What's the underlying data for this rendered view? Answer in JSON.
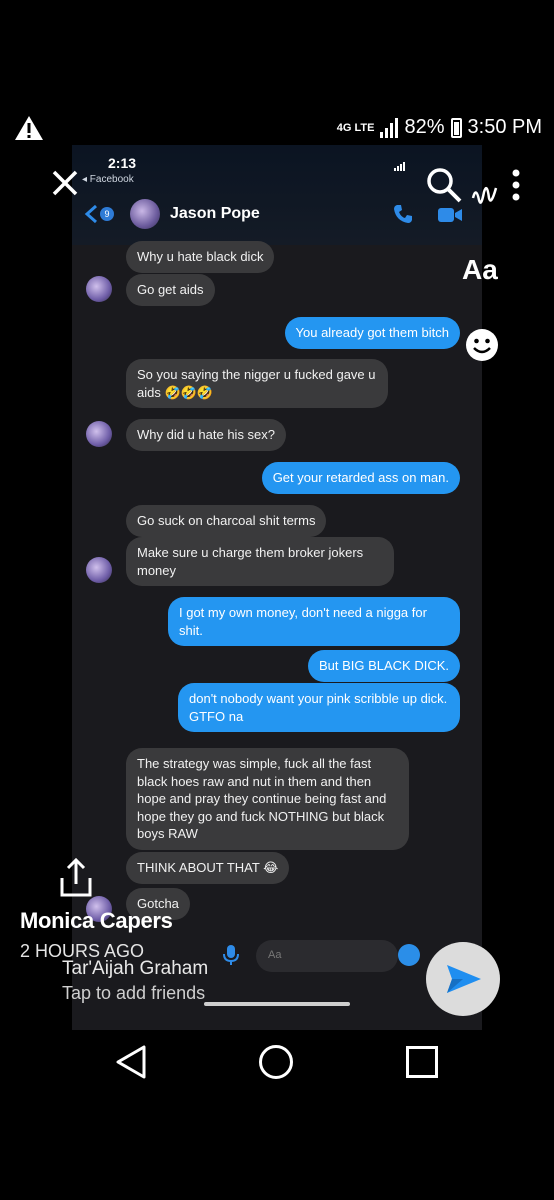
{
  "status_bar": {
    "network": "4G LTE",
    "battery": "82%",
    "time": "3:50 PM"
  },
  "overlay": {
    "aa_label": "Aa",
    "author": "Monica Capers",
    "time_ago": "2 HOURS AGO",
    "friend_name": "Tar'Aijah Graham",
    "tap_hint": "Tap to add friends"
  },
  "messenger": {
    "clock": "2:13",
    "back_label": "◂ Facebook",
    "badge_count": "9",
    "contact_name": "Jason Pope",
    "input_placeholder": "Aa",
    "messages": [
      {
        "dir": "in",
        "text": "Why u hate black dick"
      },
      {
        "dir": "in",
        "text": "Go get aids"
      },
      {
        "dir": "out",
        "text": "You already got them bitch"
      },
      {
        "dir": "in",
        "text": "So you saying the nigger u fucked gave u aids 🤣🤣🤣"
      },
      {
        "dir": "in",
        "text": "Why did u hate his sex?"
      },
      {
        "dir": "out",
        "text": "Get your retarded ass on man."
      },
      {
        "dir": "in",
        "text": "Go suck on charcoal shit terms"
      },
      {
        "dir": "in",
        "text": "Make sure u charge them broker jokers money"
      },
      {
        "dir": "out",
        "text": "I got my own money, don't need a nigga for shit."
      },
      {
        "dir": "out",
        "text": "But BIG BLACK DICK."
      },
      {
        "dir": "out",
        "text": "don't nobody want your pink scribble up dick. GTFO na"
      },
      {
        "dir": "in",
        "text": "The strategy was simple, fuck all the fast black hoes raw and nut in them and then hope and pray they continue being fast and hope they go and fuck NOTHING but black boys RAW"
      },
      {
        "dir": "in",
        "text": "THINK ABOUT THAT 😂"
      },
      {
        "dir": "in",
        "text": "Gotcha"
      }
    ]
  },
  "colors": {
    "incoming_bubble": "#3a3a3c",
    "outgoing_bubble": "#2496f1",
    "accent": "#2e7bd6"
  }
}
